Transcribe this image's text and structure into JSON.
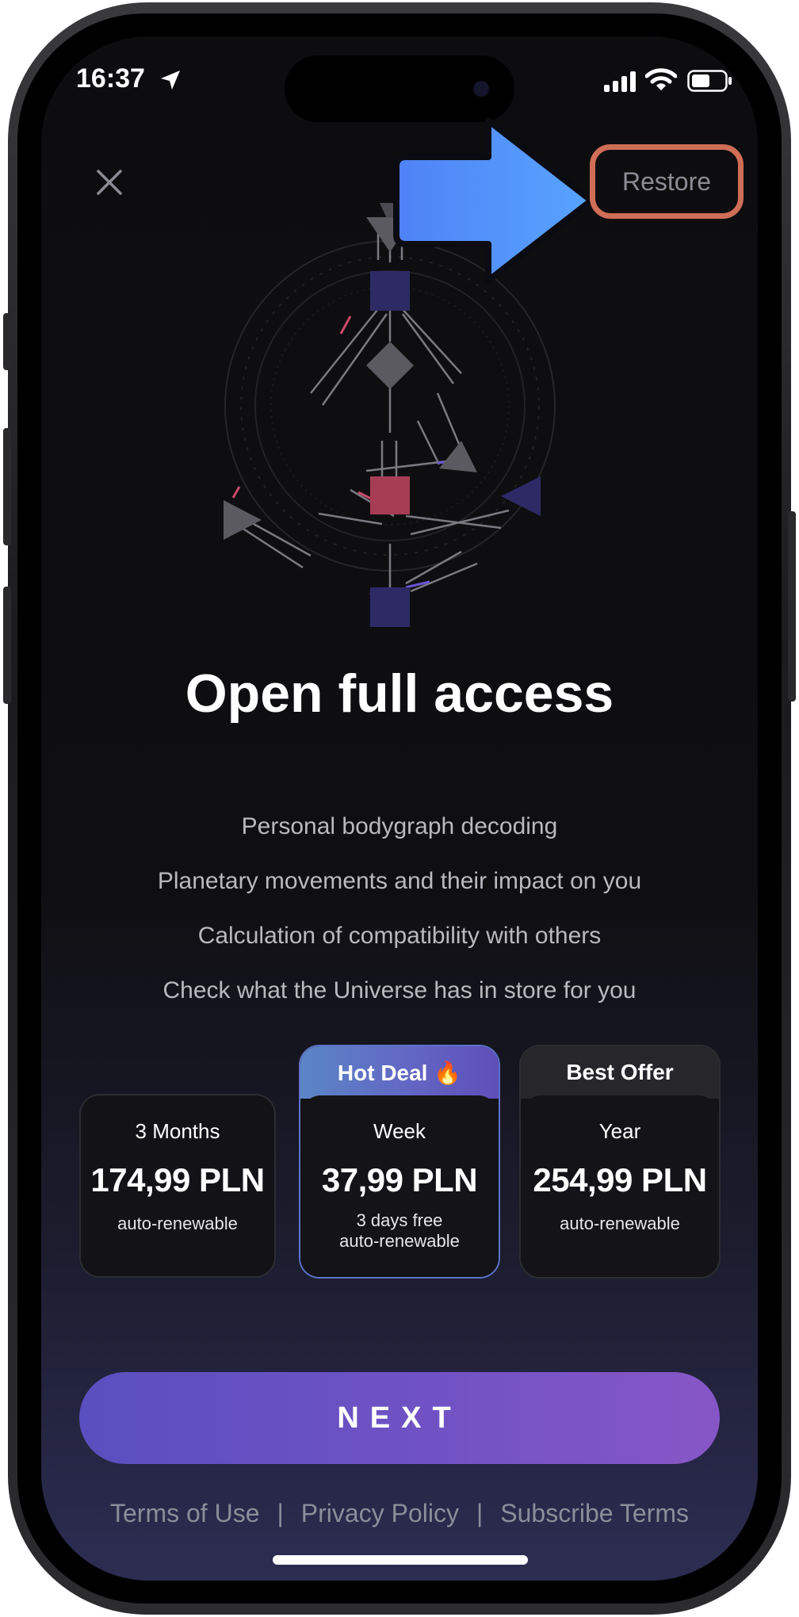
{
  "status_bar": {
    "time": "16:37"
  },
  "paywall": {
    "restore_label": "Restore",
    "headline": "Open full access",
    "features": [
      "Personal bodygraph decoding",
      "Planetary movements and their impact on you",
      "Calculation of compatibility with others",
      "Check what the Universe has in store for you"
    ],
    "plans": [
      {
        "badge": "",
        "name": "3 Months",
        "price": "174,99 PLN",
        "note_line1": "auto-renewable",
        "note_line2": ""
      },
      {
        "badge": "Hot Deal 🔥",
        "name": "Week",
        "price": "37,99 PLN",
        "note_line1": "3 days free",
        "note_line2": "auto-renewable"
      },
      {
        "badge": "Best Offer",
        "name": "Year",
        "price": "254,99 PLN",
        "note_line1": "auto-renewable",
        "note_line2": ""
      }
    ],
    "selected_plan": "Week",
    "next_label": "NEXT",
    "footer": {
      "terms": "Terms of Use",
      "privacy": "Privacy Policy",
      "subscribe_terms": "Subscribe Terms",
      "separator": "|"
    }
  },
  "colors": {
    "accent_button_start": "#5a4fc0",
    "accent_button_end": "#8756c6",
    "restore_highlight": "#cf6e57",
    "arrow_annotation": "#4f8cff",
    "selected_plan_border": "#5d72c8"
  },
  "icons": [
    "location-arrow-icon",
    "signal-icon",
    "wifi-icon",
    "battery-icon",
    "close-icon",
    "arrow-right-annotation-icon"
  ]
}
